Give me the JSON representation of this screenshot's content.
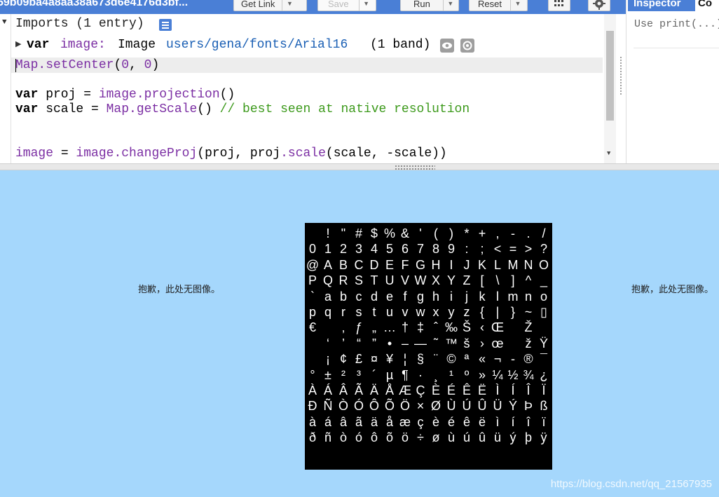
{
  "toolbar": {
    "script_title": "59b09ba4a8aa38a673d6e4176d3bf...",
    "get_link_label": "Get Link",
    "save_label": "Save",
    "run_label": "Run",
    "reset_label": "Reset",
    "apps_icon": "grid-icon",
    "settings_icon": "gear-icon"
  },
  "right_panel": {
    "tab_inspector": "Inspector",
    "tab_console": "Co",
    "content": "Use print(...)"
  },
  "editor": {
    "imports_header": "Imports (1 entry)",
    "import_var_keyword": "var",
    "import_var_name": "image:",
    "import_type": "Image",
    "import_path": "users/gena/fonts/Arial16",
    "import_bands": "(1 band)",
    "lines": {
      "l1_obj": "Map",
      "l1_method": ".setCenter",
      "l1_paren_open": "(",
      "l1_arg1": "0",
      "l1_sep": ", ",
      "l1_arg2": "0",
      "l1_paren_close": ")",
      "l2_kw": "var",
      "l2_rest": " proj = ",
      "l2_obj": "image",
      "l2_method": ".projection",
      "l2_end": "()",
      "l3_kw": "var",
      "l3_rest": " scale = ",
      "l3_obj": "Map",
      "l3_method": ".getScale",
      "l3_end": "() ",
      "l3_comment": "// best seen at native resolution",
      "l4_lhs": "image",
      "l4_eq": " = ",
      "l4_obj": "image",
      "l4_method": ".changeProj",
      "l4_mid": "(proj, proj",
      "l4_method2": ".scale",
      "l4_end": "(scale, -scale))"
    }
  },
  "map": {
    "tile_error_left": "抱歉，此处无图像。",
    "tile_error_right": "抱歉，此处无图像。",
    "glyph_rows": [
      [
        "",
        "!",
        "\"",
        "#",
        "$",
        "%",
        "&",
        "'",
        "(",
        ")",
        "*",
        "+",
        ",",
        "-",
        ".",
        "/"
      ],
      [
        "0",
        "1",
        "2",
        "3",
        "4",
        "5",
        "6",
        "7",
        "8",
        "9",
        ":",
        ";",
        "<",
        "=",
        ">",
        "?"
      ],
      [
        "@",
        "A",
        "B",
        "C",
        "D",
        "E",
        "F",
        "G",
        "H",
        "I",
        "J",
        "K",
        "L",
        "M",
        "N",
        "O"
      ],
      [
        "P",
        "Q",
        "R",
        "S",
        "T",
        "U",
        "V",
        "W",
        "X",
        "Y",
        "Z",
        "[",
        "\\",
        "]",
        "^",
        "_"
      ],
      [
        "`",
        "a",
        "b",
        "c",
        "d",
        "e",
        "f",
        "g",
        "h",
        "i",
        "j",
        "k",
        "l",
        "m",
        "n",
        "o"
      ],
      [
        "p",
        "q",
        "r",
        "s",
        "t",
        "u",
        "v",
        "w",
        "x",
        "y",
        "z",
        "{",
        "|",
        "}",
        "~",
        "▯"
      ],
      [
        "€",
        "",
        "‚",
        "ƒ",
        "„",
        "…",
        "†",
        "‡",
        "ˆ",
        "‰",
        "Š",
        "‹",
        "Œ",
        "",
        "Ž",
        ""
      ],
      [
        "",
        "‘",
        "’",
        "“",
        "”",
        "•",
        "–",
        "—",
        "˜",
        "™",
        "š",
        "›",
        "œ",
        "",
        "ž",
        "Ÿ"
      ],
      [
        "",
        "¡",
        "¢",
        "£",
        "¤",
        "¥",
        "¦",
        "§",
        "¨",
        "©",
        "ª",
        "«",
        "¬",
        "-",
        "®",
        "¯"
      ],
      [
        "°",
        "±",
        "²",
        "³",
        "´",
        "µ",
        "¶",
        "·",
        "¸",
        "¹",
        "º",
        "»",
        "¼",
        "½",
        "¾",
        "¿"
      ],
      [
        "À",
        "Á",
        "Â",
        "Ã",
        "Ä",
        "Å",
        "Æ",
        "Ç",
        "È",
        "É",
        "Ê",
        "Ë",
        "Ì",
        "Í",
        "Î",
        "Ï"
      ],
      [
        "Ð",
        "Ñ",
        "Ò",
        "Ó",
        "Ô",
        "Õ",
        "Ö",
        "×",
        "Ø",
        "Ù",
        "Ú",
        "Û",
        "Ü",
        "Ý",
        "Þ",
        "ß"
      ],
      [
        "à",
        "á",
        "â",
        "ã",
        "ä",
        "å",
        "æ",
        "ç",
        "è",
        "é",
        "ê",
        "ë",
        "ì",
        "í",
        "î",
        "ï"
      ],
      [
        "ð",
        "ñ",
        "ò",
        "ó",
        "ô",
        "õ",
        "ö",
        "÷",
        "ø",
        "ù",
        "ú",
        "û",
        "ü",
        "ý",
        "þ",
        "ÿ"
      ]
    ],
    "watermark": "https://blog.csdn.net/qq_21567935"
  },
  "colors": {
    "accent_blue": "#4a7fd6",
    "map_background": "#a5d7fc",
    "keyword": "#000000",
    "method_purple": "#7b2ea3",
    "number_purple": "#7b2ea3",
    "string_blue": "#1a5fb4",
    "comment_green": "#3d9a1c"
  }
}
